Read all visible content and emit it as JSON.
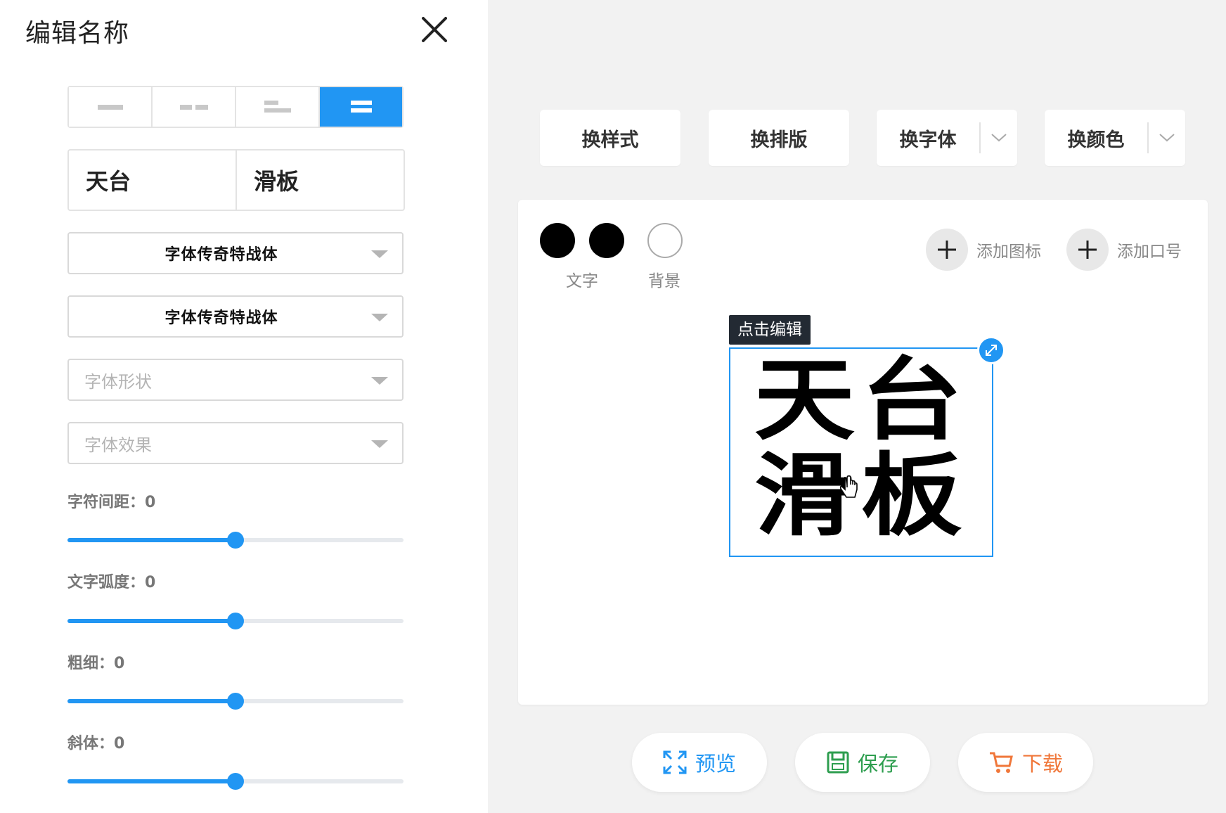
{
  "panel": {
    "title": "编辑名称",
    "name_parts": [
      "天台",
      "滑板"
    ],
    "font_select_1": "字体传奇特战体",
    "font_select_2": "字体传奇特战体",
    "shape_placeholder": "字体形状",
    "effect_placeholder": "字体效果",
    "sliders": [
      {
        "label": "字符间距：0",
        "value": 0,
        "fraction": 0.5
      },
      {
        "label": "文字弧度：0",
        "value": 0,
        "fraction": 0.5
      },
      {
        "label": "粗细：0",
        "value": 0,
        "fraction": 0.5
      },
      {
        "label": "斜体：0",
        "value": 0,
        "fraction": 0.5
      }
    ],
    "active_layout_index": 3
  },
  "toolbar": {
    "change_style": "换样式",
    "change_layout": "换排版",
    "change_font": "换字体",
    "change_color": "换颜色"
  },
  "canvas": {
    "text_color_label": "文字",
    "bg_color_label": "背景",
    "add_icon": "添加图标",
    "add_slogan": "添加口号",
    "edit_tag": "点击编辑",
    "logo_line1": "天台",
    "logo_line2": "滑板"
  },
  "actions": {
    "preview": "预览",
    "save": "保存",
    "download": "下载"
  },
  "colors": {
    "accent": "#2196f3",
    "save": "#2e9e4f",
    "download": "#f0773a"
  }
}
